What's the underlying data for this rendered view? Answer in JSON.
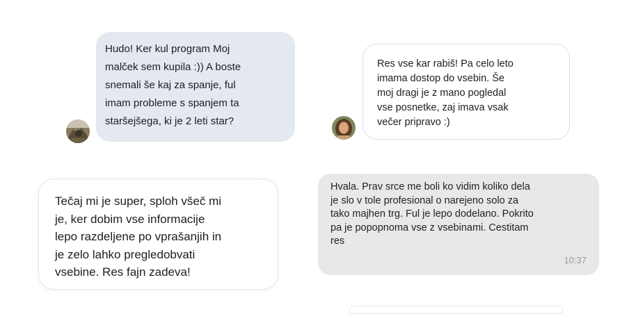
{
  "messages": [
    {
      "id": "m1",
      "text": "Hudo! Ker kul program Moj\nmalček sem kupila :)) A boste\nsnemali še kaj za spanje, ful\nimam probleme s spanjem ta\nstaršejšega, ki je 2 leti star?",
      "has_avatar": true
    },
    {
      "id": "m2",
      "text": "Res vse kar rabiš! Pa celo leto\nimama dostop do vsebin. Še\nmoj dragi je z mano pogledal\nvse posnetke, zaj imava vsak\nvečer pripravo :)",
      "has_avatar": true
    },
    {
      "id": "m3",
      "text": "Tečaj mi je super, sploh všeč mi\nje, ker dobim vse informacije\nlepo razdeljene po vprašanjih in\nje zelo lahko pregledobvati\nvsebine. Res fajn zadeva!"
    },
    {
      "id": "m4",
      "text": "Hvala. Prav srce me boli ko vidim koliko dela\nje slo v tole profesional o narejeno solo za\ntako majhen trg. Ful je lepo dodelano. Pokrito\npa je popopnoma vse z vsebinami. Cestitam\nres",
      "time": "10:37"
    }
  ],
  "colors": {
    "bubble_blue": "#e4e9f0",
    "bubble_gray": "#e8e8e8",
    "bubble_white": "#ffffff",
    "timestamp": "#9a9a9a"
  }
}
